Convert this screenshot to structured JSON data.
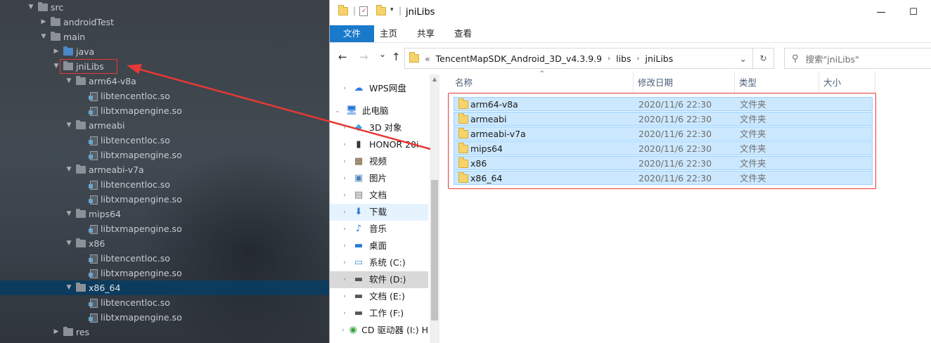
{
  "ide_tree": {
    "rows": [
      {
        "label": "src",
        "arrow": "▼",
        "icon": "folder",
        "expanded": true
      },
      {
        "label": "androidTest",
        "arrow": "▶",
        "icon": "folder"
      },
      {
        "label": "main",
        "arrow": "▼",
        "icon": "folder",
        "expanded": true
      },
      {
        "label": "java",
        "arrow": "▶",
        "icon": "folder-blue"
      },
      {
        "label": "jniLibs",
        "arrow": "▼",
        "icon": "folder",
        "expanded": true
      },
      {
        "label": "arm64-v8a",
        "arrow": "▼",
        "icon": "folder"
      },
      {
        "label": "libtencentloc.so",
        "icon": "so-file"
      },
      {
        "label": "libtxmapengine.so",
        "icon": "so-file"
      },
      {
        "label": "armeabi",
        "arrow": "▼",
        "icon": "folder"
      },
      {
        "label": "libtencentloc.so",
        "icon": "so-file"
      },
      {
        "label": "libtxmapengine.so",
        "icon": "so-file"
      },
      {
        "label": "armeabi-v7a",
        "arrow": "▼",
        "icon": "folder"
      },
      {
        "label": "libtencentloc.so",
        "icon": "so-file"
      },
      {
        "label": "libtxmapengine.so",
        "icon": "so-file"
      },
      {
        "label": "mips64",
        "arrow": "▼",
        "icon": "folder"
      },
      {
        "label": "libtxmapengine.so",
        "icon": "so-file"
      },
      {
        "label": "x86",
        "arrow": "▼",
        "icon": "folder"
      },
      {
        "label": "libtencentloc.so",
        "icon": "so-file"
      },
      {
        "label": "libtxmapengine.so",
        "icon": "so-file"
      },
      {
        "label": "x86_64",
        "arrow": "▼",
        "icon": "folder",
        "selected": true
      },
      {
        "label": "libtencentloc.so",
        "icon": "so-file"
      },
      {
        "label": "libtxmapengine.so",
        "icon": "so-file"
      },
      {
        "label": "res",
        "arrow": "▶",
        "icon": "folder"
      }
    ],
    "highlighted_item": "jniLibs"
  },
  "explorer": {
    "title": "jniLibs",
    "window_controls": {
      "minimize": "—",
      "maximize": "☐"
    },
    "ribbon_tabs": [
      "文件",
      "主页",
      "共享",
      "查看"
    ],
    "nav": {
      "back": "←",
      "forward": "→",
      "dropdown": "⌄",
      "up": "↑"
    },
    "address": {
      "prefix": "«",
      "segments": [
        "TencentMapSDK_Android_3D_v4.3.9.9",
        "libs",
        "jniLibs"
      ],
      "dropdown": "⌄"
    },
    "refresh": "↻",
    "search_placeholder": "搜索\"jniLibs\"",
    "nav_pane": [
      {
        "label": "WPS网盘",
        "chev": "›",
        "icon": "cloud-icon"
      },
      {
        "label": "此电脑",
        "chev": "⌄",
        "icon": "computer-icon"
      },
      {
        "label": "3D 对象",
        "chev": "›",
        "icon": "cube-icon"
      },
      {
        "label": "HONOR 20i",
        "chev": "›",
        "icon": "phone-icon"
      },
      {
        "label": "视频",
        "chev": "›",
        "icon": "video-icon"
      },
      {
        "label": "图片",
        "chev": "›",
        "icon": "picture-icon"
      },
      {
        "label": "文档",
        "chev": "›",
        "icon": "document-icon"
      },
      {
        "label": "下载",
        "chev": "›",
        "icon": "download-icon",
        "state": "hover"
      },
      {
        "label": "音乐",
        "chev": "›",
        "icon": "music-icon"
      },
      {
        "label": "桌面",
        "chev": "›",
        "icon": "desktop-icon"
      },
      {
        "label": "系统 (C:)",
        "chev": "›",
        "icon": "system-drive-icon"
      },
      {
        "label": "软件 (D:)",
        "chev": "›",
        "icon": "drive-icon",
        "state": "selected"
      },
      {
        "label": "文档 (E:)",
        "chev": "›",
        "icon": "drive-icon"
      },
      {
        "label": "工作 (F:)",
        "chev": "›",
        "icon": "drive-icon"
      },
      {
        "label": "CD 驱动器 (I:) H",
        "chev": "›",
        "icon": "cd-drive-icon"
      }
    ],
    "columns": [
      "名称",
      "修改日期",
      "类型",
      "大小"
    ],
    "files": [
      {
        "name": "arm64-v8a",
        "date": "2020/11/6 22:30",
        "type": "文件夹"
      },
      {
        "name": "armeabi",
        "date": "2020/11/6 22:30",
        "type": "文件夹"
      },
      {
        "name": "armeabi-v7a",
        "date": "2020/11/6 22:30",
        "type": "文件夹"
      },
      {
        "name": "mips64",
        "date": "2020/11/6 22:30",
        "type": "文件夹"
      },
      {
        "name": "x86",
        "date": "2020/11/6 22:30",
        "type": "文件夹"
      },
      {
        "name": "x86_64",
        "date": "2020/11/6 22:30",
        "type": "文件夹"
      }
    ]
  },
  "colors": {
    "annotation_red": "#e53935",
    "ribbon_file_tab": "#1979ca",
    "row_selected": "#cce8ff",
    "ide_selection": "#0d3b5e"
  }
}
